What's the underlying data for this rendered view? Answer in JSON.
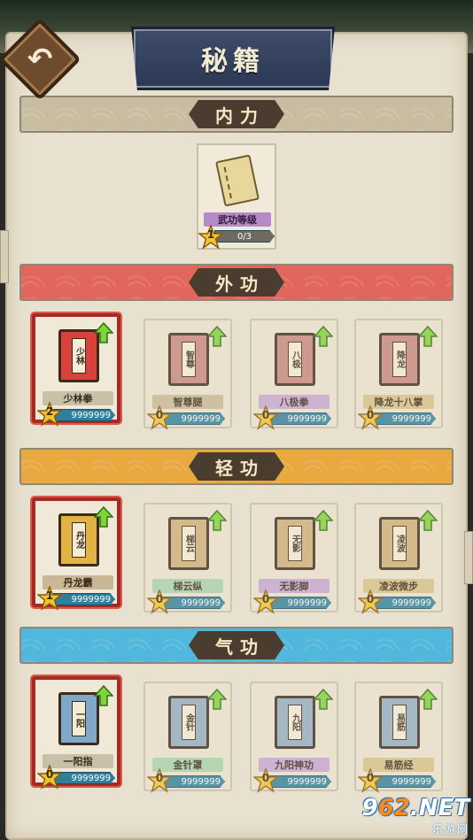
{
  "header": {
    "title": "秘籍",
    "back_icon": "back-arrow-icon"
  },
  "sections": [
    {
      "id": "neili",
      "label": "内力",
      "color": "#c9bda1",
      "cards": [
        {
          "name": "武功等级",
          "star": "1",
          "count": "0/3"
        }
      ]
    },
    {
      "id": "waigong",
      "label": "外功",
      "color": "#e1675c",
      "cards": [
        {
          "name": "少林拳",
          "spine": "少林",
          "star": "2",
          "count": "9999999",
          "selected": true
        },
        {
          "name": "智尊腿",
          "spine": "智尊",
          "star": "0",
          "count": "9999999",
          "selected": false
        },
        {
          "name": "八极拳",
          "spine": "八极",
          "star": "0",
          "count": "9999999",
          "selected": false
        },
        {
          "name": "降龙十八掌",
          "spine": "降龙",
          "star": "0",
          "count": "9999999",
          "selected": false
        }
      ]
    },
    {
      "id": "qinggong",
      "label": "轻功",
      "color": "#e8a940",
      "cards": [
        {
          "name": "丹龙霸",
          "spine": "丹龙",
          "star": "1",
          "count": "9999999",
          "selected": true
        },
        {
          "name": "梯云纵",
          "spine": "梯云",
          "star": "0",
          "count": "9999999",
          "selected": false
        },
        {
          "name": "无影脚",
          "spine": "无影",
          "star": "0",
          "count": "9999999",
          "selected": false
        },
        {
          "name": "凌波微步",
          "spine": "凌波",
          "star": "0",
          "count": "9999999",
          "selected": false
        }
      ]
    },
    {
      "id": "qigong",
      "label": "气功",
      "color": "#52b7dc",
      "cards": [
        {
          "name": "一阳指",
          "spine": "一阳",
          "star": "0",
          "count": "9999999",
          "selected": true
        },
        {
          "name": "金针罩",
          "spine": "金针",
          "star": "0",
          "count": "9999999",
          "selected": false
        },
        {
          "name": "九阳神功",
          "spine": "九阳",
          "star": "0",
          "count": "9999999",
          "selected": false
        },
        {
          "name": "易筋经",
          "spine": "易筋",
          "star": "0",
          "count": "9999999",
          "selected": false
        }
      ]
    }
  ],
  "watermark": {
    "main_a": "9",
    "main_b": "62",
    "main_c": ".NET",
    "sub": "乐游网"
  },
  "icons": {
    "upgrade": "upgrade-arrow-icon",
    "star": "star-icon",
    "book": "book-icon"
  }
}
